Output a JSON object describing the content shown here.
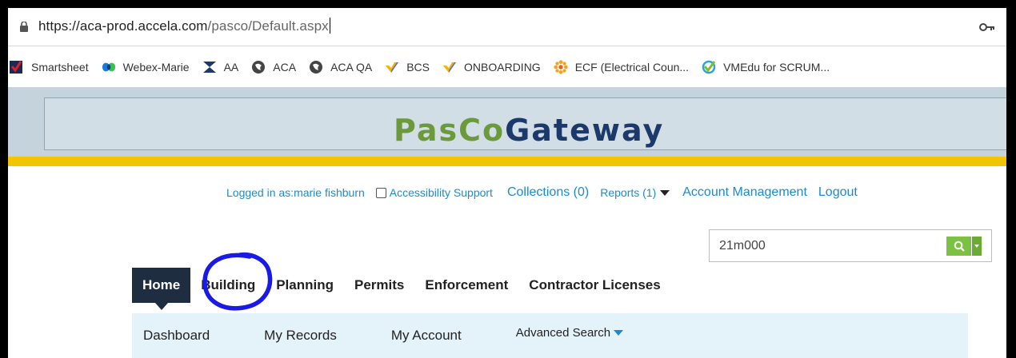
{
  "browser": {
    "url_host": "https://aca-prod.accela.com",
    "url_path": "/pasco/Default.aspx"
  },
  "bookmarks": [
    {
      "label": "Smartsheet",
      "icon": "smartsheet-icon"
    },
    {
      "label": "Webex-Marie",
      "icon": "webex-icon"
    },
    {
      "label": "AA",
      "icon": "accela-icon"
    },
    {
      "label": "ACA",
      "icon": "globe-icon"
    },
    {
      "label": "ACA QA",
      "icon": "globe-icon"
    },
    {
      "label": "BCS",
      "icon": "bcs-icon"
    },
    {
      "label": "ONBOARDING",
      "icon": "bcs-icon"
    },
    {
      "label": "ECF (Electrical Coun...",
      "icon": "flower-icon"
    },
    {
      "label": "VMEdu for SCRUM...",
      "icon": "vmedu-icon"
    }
  ],
  "site": {
    "logo_part1": "PasCo",
    "logo_part2": "Gateway",
    "colors": {
      "logo_green": "#6b9a3a",
      "logo_navy": "#1b3a6b",
      "accent_yellow": "#f2c500",
      "link_blue": "#1a8bd1",
      "active_tab": "#1f2d40"
    }
  },
  "toplinks": {
    "logged_in": "Logged in as:marie fishburn",
    "accessibility": "Accessibility Support",
    "collections": "Collections (0)",
    "reports": "Reports (1)",
    "account": "Account Management",
    "logout": "Logout"
  },
  "search": {
    "value": "21m000"
  },
  "nav": {
    "tabs": [
      "Home",
      "Building",
      "Planning",
      "Permits",
      "Enforcement",
      "Contractor Licenses"
    ],
    "active": "Home"
  },
  "subnav": {
    "items": [
      "Dashboard",
      "My Records",
      "My Account"
    ],
    "advanced": "Advanced Search"
  }
}
